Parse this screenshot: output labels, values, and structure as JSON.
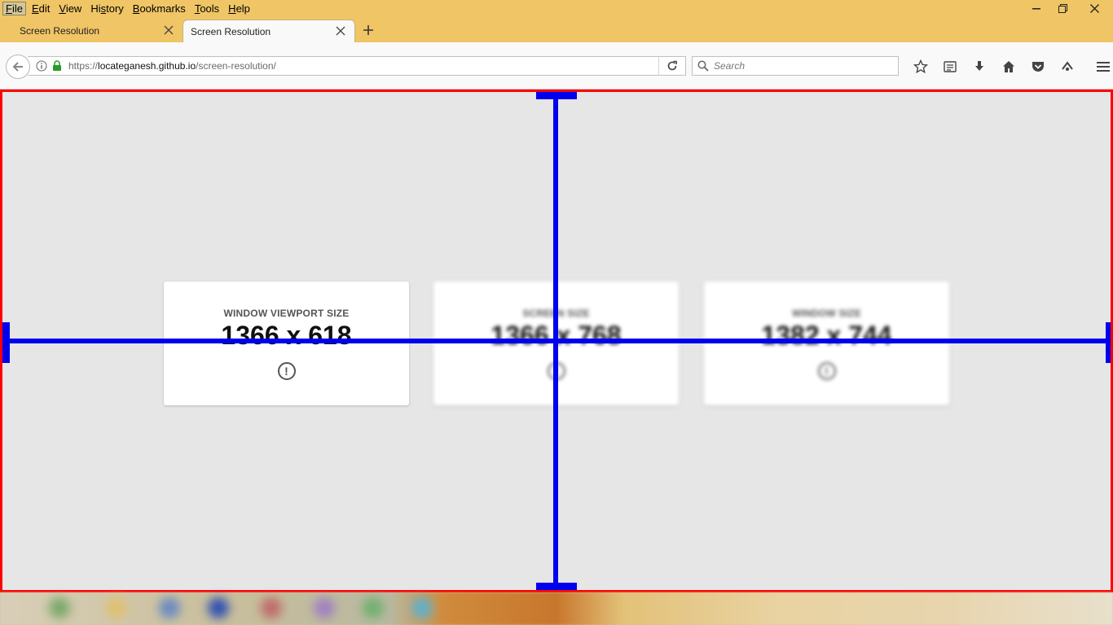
{
  "menubar": {
    "items": [
      "File",
      "Edit",
      "View",
      "History",
      "Bookmarks",
      "Tools",
      "Help"
    ],
    "underline_index": [
      0,
      0,
      0,
      2,
      0,
      0,
      0
    ]
  },
  "tabs": [
    {
      "title": "Screen Resolution"
    },
    {
      "title": "Screen Resolution"
    }
  ],
  "navbar": {
    "url_prefix": "https://",
    "url_host": "locateganesh.github.io",
    "url_path": "/screen-resolution/",
    "search_placeholder": "Search"
  },
  "cards": [
    {
      "label": "WINDOW VIEWPORT SIZE",
      "value": "1366 x 618",
      "info": "!"
    },
    {
      "label": "SCREEN SIZE",
      "value": "1366 x 768",
      "info": "!"
    },
    {
      "label": "WINDOW SIZE",
      "value": "1382 x 744",
      "info": "!"
    }
  ],
  "colors": {
    "titlebar": "#f0c566",
    "page_border": "#ff0000",
    "measure_lines": "#0000ee",
    "page_bg": "#e6e6e6"
  },
  "icons": [
    "back-arrow-icon",
    "info-icon",
    "lock-icon",
    "reload-icon",
    "search-icon",
    "star-icon",
    "reading-list-icon",
    "download-icon",
    "home-icon",
    "pocket-icon",
    "extension-icon",
    "hamburger-menu-icon",
    "close-icon",
    "plus-icon",
    "minimize-icon",
    "restore-icon"
  ]
}
